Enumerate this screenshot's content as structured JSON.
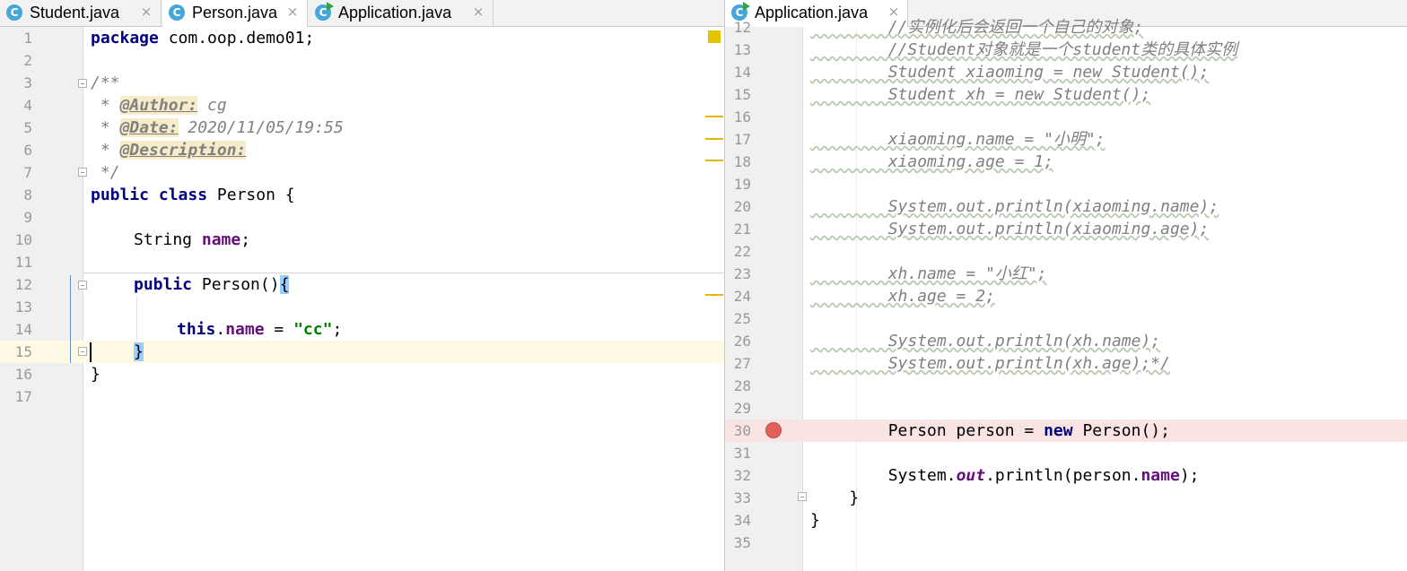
{
  "left_tabs": [
    {
      "label": "Student.java",
      "icon": "class-icon",
      "active": false
    },
    {
      "label": "Person.java",
      "icon": "class-icon",
      "active": true
    },
    {
      "label": "Application.java",
      "icon": "run-class-icon",
      "active": false
    }
  ],
  "right_tabs": [
    {
      "label": "Application.java",
      "icon": "run-class-icon",
      "active": true
    }
  ],
  "tab_close_glyph": "×",
  "left_editor": {
    "file": "Person.java",
    "line_numbers": [
      "1",
      "2",
      "3",
      "4",
      "5",
      "6",
      "7",
      "8",
      "9",
      "10",
      "11",
      "12",
      "13",
      "14",
      "15",
      "16",
      "17"
    ],
    "caret_line": "15",
    "lines": {
      "l1": {
        "kw": "package",
        "rest": " com.oop.demo01;"
      },
      "l3": {
        "doc": "/**"
      },
      "l4": {
        "pre": " * ",
        "tag": "@Author:",
        "val": " cg"
      },
      "l5": {
        "pre": " * ",
        "tag": "@Date:",
        "val": " 2020/11/05/19:55"
      },
      "l6": {
        "pre": " * ",
        "tag": "@Description:"
      },
      "l7": {
        "doc": " */"
      },
      "l8": {
        "kw1": "public",
        "kw2": "class",
        "rest": " Person {"
      },
      "l10": {
        "type": "String ",
        "fld": "name",
        "rest": ";"
      },
      "l12": {
        "kw": "public",
        "rest": " Person()",
        "brace": "{"
      },
      "l14": {
        "kw": "this",
        "dot": ".",
        "fld": "name",
        "eq": " = ",
        "str": "\"cc\"",
        "end": ";"
      },
      "l15": {
        "brace": "}"
      },
      "l16": {
        "text": "}"
      }
    }
  },
  "right_editor": {
    "file": "Application.java",
    "line_numbers": [
      "12",
      "13",
      "14",
      "15",
      "16",
      "17",
      "18",
      "19",
      "20",
      "21",
      "22",
      "23",
      "24",
      "25",
      "26",
      "27",
      "28",
      "29",
      "30",
      "31",
      "32",
      "33",
      "34",
      "35"
    ],
    "breakpoint_line": "30",
    "lines": {
      "l12": "        //实例化后会返回一个自己的对象;",
      "l13": "        //Student对象就是一个student类的具体实例",
      "l14": "        Student xiaoming = new Student();",
      "l15": "        Student xh = new Student();",
      "l17": "        xiaoming.name = \"小明\";",
      "l18": "        xiaoming.age = 1;",
      "l20": "        System.out.println(xiaoming.name);",
      "l21": "        System.out.println(xiaoming.age);",
      "l23": "        xh.name = \"小红\";",
      "l24": "        xh.age = 2;",
      "l26": "        System.out.println(xh.name);",
      "l27": "        System.out.println(xh.age);*/",
      "l30": {
        "pre": "        Person person = ",
        "kw": "new",
        "rest": " Person();"
      },
      "l32": {
        "pre": "        System.",
        "out": "out",
        "mid": ".println(person.",
        "fld": "name",
        "end": ");"
      },
      "l33": "    }",
      "l34": "}"
    }
  },
  "colors": {
    "keyword": "#000080",
    "field": "#660e7a",
    "string": "#008000",
    "comment": "#808080",
    "caret_row": "#fffae3",
    "breakpoint_row": "#fae3e3",
    "breakpoint": "#e0605a",
    "warning_marker": "#e3b700"
  }
}
